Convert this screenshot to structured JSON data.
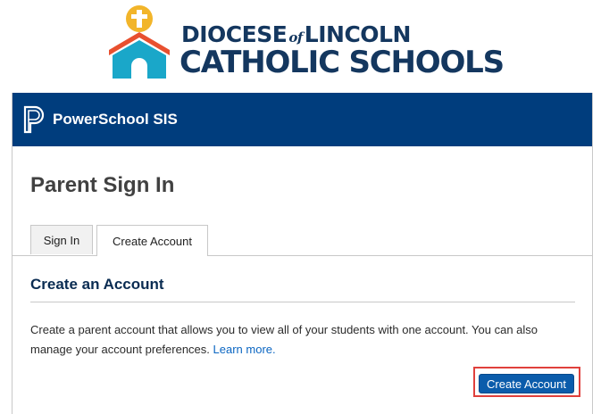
{
  "branding": {
    "line1_part1": "DIOCESE",
    "line1_of": "of",
    "line1_part2": "LINCOLN",
    "line2": "CATHOLIC SCHOOLS",
    "colors": {
      "navy": "#14375f",
      "teal": "#1aa7c9",
      "orange": "#e8502f",
      "gold": "#f2b52a"
    }
  },
  "header": {
    "app_name": "PowerSchool SIS",
    "icon": "powerschool-p-logo",
    "bg_color": "#003d7d"
  },
  "page": {
    "title": "Parent Sign In"
  },
  "tabs": [
    {
      "label": "Sign In",
      "active": false
    },
    {
      "label": "Create Account",
      "active": true
    }
  ],
  "create_section": {
    "title": "Create an Account",
    "description": "Create a parent account that allows you to view all of your students with one account. You can also manage your account preferences.",
    "learn_more": "Learn more.",
    "button_label": "Create Account",
    "button_color": "#0b5cab",
    "highlight_color": "#e0403c"
  }
}
